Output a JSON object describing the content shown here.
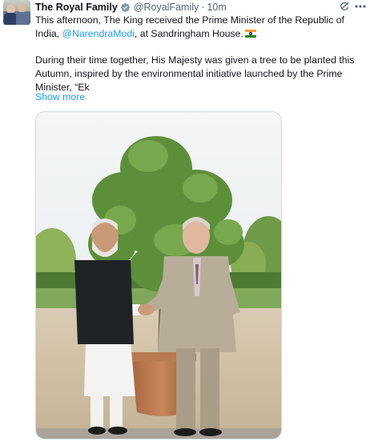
{
  "post": {
    "author_name": "The Royal Family",
    "handle": "@RoyalFamily",
    "separator": "·",
    "time": "10m",
    "text_line1_a": "This afternoon, The King received the Prime Minister of the Republic of India, ",
    "mention": "@NarendraModi",
    "text_line1_b": ", at Sandringham House.",
    "text_para2": "During their time together, His Majesty was given a tree to be planted this Autumn, inspired by the environmental initiative launched by the Prime Minister, “Ek",
    "show_more": "Show more"
  },
  "icons": {
    "verified": "verified-badge-icon",
    "grok": "grok-icon",
    "more": "more-options-icon",
    "flag": "india-flag-emoji"
  },
  "colors": {
    "link": "#1d9bf0",
    "verified": "#829aab",
    "secondary_text": "#536471"
  }
}
